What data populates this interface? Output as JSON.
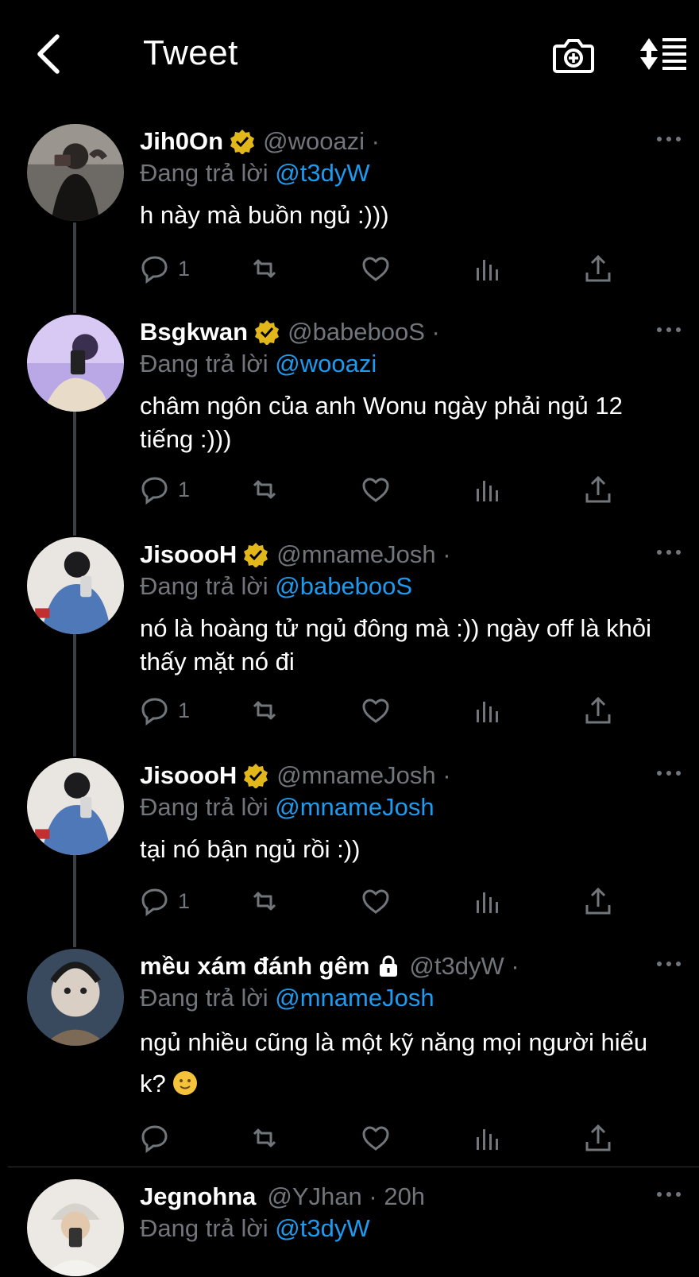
{
  "header": {
    "title": "Tweet"
  },
  "colors": {
    "background": "#000000",
    "mention": "#1d9bf0",
    "muted": "#71767b",
    "verified": "#e2b719"
  },
  "tweets": [
    {
      "name": "Jih0On",
      "handle": "@wooazi ·",
      "replying_prefix": "Đang trả lời",
      "replying_to": "@t3dyW",
      "text": "h này mà buồn ngủ :)))",
      "reply_count": "1",
      "badge": "verified-gold"
    },
    {
      "name": "Bsgkwan",
      "handle": "@babebooS ·",
      "replying_prefix": "Đang trả lời",
      "replying_to": "@wooazi",
      "text": "châm ngôn của anh Wonu ngày phải ngủ 12 tiếng :)))",
      "reply_count": "1",
      "badge": "verified-gold"
    },
    {
      "name": "JisoooH",
      "handle": "@mnameJosh ·",
      "replying_prefix": "Đang trả lời",
      "replying_to": "@babebooS",
      "text": "nó là hoàng tử ngủ đông mà :)) ngày off là khỏi thấy mặt nó đi",
      "reply_count": "1",
      "badge": "verified-gold"
    },
    {
      "name": "JisoooH",
      "handle": "@mnameJosh ·",
      "replying_prefix": "Đang trả lời",
      "replying_to": "@mnameJosh",
      "text": "tại nó bận ngủ rồi :))",
      "reply_count": "1",
      "badge": "verified-gold"
    },
    {
      "name": "mều xám đánh gêm",
      "handle": "@t3dyW ·",
      "replying_prefix": "Đang trả lời",
      "replying_to": "@mnameJosh",
      "text": "ngủ nhiều cũng là một kỹ năng mọi người hiểu k?",
      "reply_count": "",
      "badge": "lock"
    },
    {
      "name": "Jegnohna",
      "handle": "@YJhan · 20h",
      "replying_prefix": "Đang trả lời",
      "replying_to": "@t3dyW",
      "text": "",
      "reply_count": "",
      "badge": "none"
    }
  ]
}
